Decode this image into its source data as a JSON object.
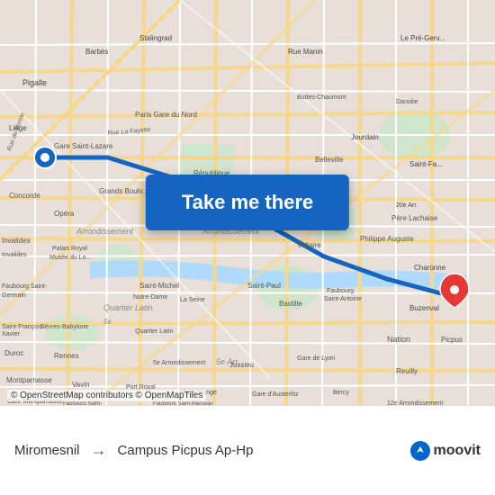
{
  "map": {
    "attribution": "© OpenStreetMap contributors © OpenMapTiles",
    "button_label": "Take me there",
    "colors": {
      "button_bg": "#1565C0",
      "route": "#1565C0",
      "dest_marker": "#e53935"
    }
  },
  "footer": {
    "from": "Miromesnil",
    "arrow": "→",
    "to": "Campus Picpus Ap-Hp",
    "logo": "moovit"
  }
}
